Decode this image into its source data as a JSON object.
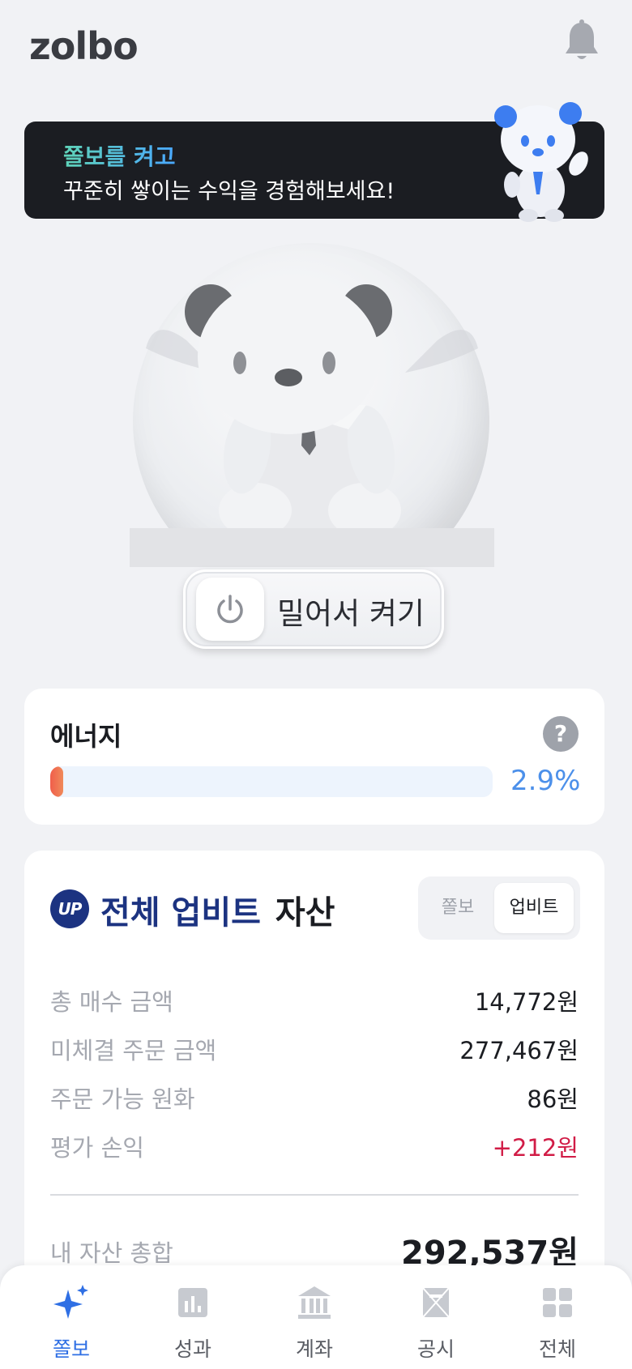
{
  "header": {
    "logo": "zolbo",
    "bell_icon": "bell-icon"
  },
  "banner": {
    "line1": "쫄보를 켜고",
    "line2": "꾸준히 쌓이는 수익을 경험해보세요!"
  },
  "toggle": {
    "label": "밀어서 켜기",
    "icon": "power-icon"
  },
  "energy": {
    "title": "에너지",
    "percent_text": "2.9%",
    "percent_value": 2.9,
    "help": "?"
  },
  "assets": {
    "logo_text": "UP",
    "title_highlight": "전체 업비트",
    "title_rest": "자산",
    "segments": [
      "쫄보",
      "업비트"
    ],
    "selected_segment": "업비트",
    "rows": [
      {
        "label": "총 매수 금액",
        "value": "14,772원"
      },
      {
        "label": "미체결 주문 금액",
        "value": "277,467원"
      },
      {
        "label": "주문 가능 원화",
        "value": "86원"
      },
      {
        "label": "평가 손익",
        "value": "+212원"
      }
    ],
    "total_label": "내 자산 총합",
    "total_value": "292,537원"
  },
  "nav": {
    "items": [
      {
        "label": "쫄보",
        "icon": "sparkle-icon",
        "active": true
      },
      {
        "label": "성과",
        "icon": "bar-chart-icon",
        "active": false
      },
      {
        "label": "계좌",
        "icon": "bank-icon",
        "active": false
      },
      {
        "label": "공시",
        "icon": "document-icon",
        "active": false
      },
      {
        "label": "전체",
        "icon": "grid-icon",
        "active": false
      }
    ]
  },
  "colors": {
    "background": "#f1f2f5",
    "banner": "#1b1d22",
    "upbit_navy": "#1c3381",
    "accent_blue": "#2f6fe4",
    "profit_red": "#d11c46",
    "energy_bar": "#f05e4b"
  }
}
